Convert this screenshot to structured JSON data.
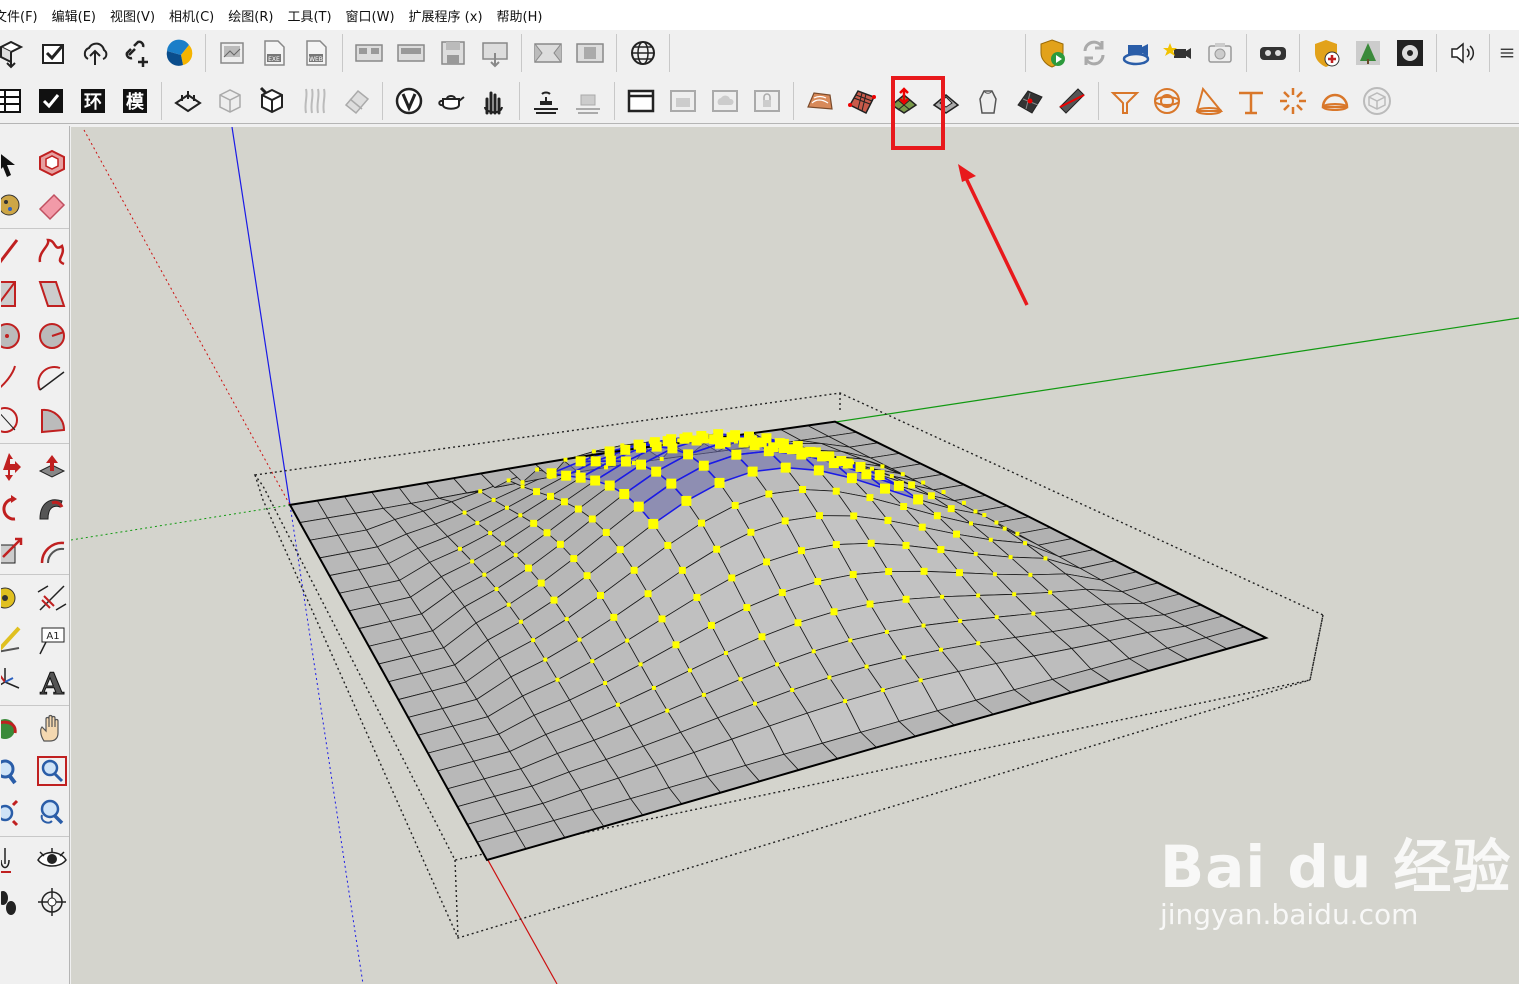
{
  "menu": [
    "文件(F)",
    "编辑(E)",
    "视图(V)",
    "相机(C)",
    "绘图(R)",
    "工具(T)",
    "窗口(W)",
    "扩展程序 (x)",
    "帮助(H)"
  ],
  "toolbar2_text_buttons": [
    "环",
    "模"
  ],
  "left_toolbar_label": "A1",
  "watermark": {
    "brand": "Bai du 经验",
    "url": "jingyan.baidu.com"
  },
  "colors": {
    "highlight": "#e8191c",
    "axis_blue": "#1a1ae6",
    "axis_green": "#119911",
    "axis_red": "#cc1111",
    "vertex": "#ffff00",
    "background": "#d4d4cd"
  },
  "icons": {
    "row1": [
      "components-icon",
      "checklist-icon",
      "cloud-upload-icon",
      "link-add-icon",
      "trimble-logo-icon",
      "export-image-icon",
      "export-exe-icon",
      "export-web-icon",
      "panorama-icon",
      "panorama-2-icon",
      "save-scene-icon",
      "scene-download-icon",
      "layout-icon",
      "layout-2-icon",
      "globe-icon",
      "shield-play-icon",
      "refresh-icon",
      "camera-rotate-icon",
      "camera-star-icon",
      "camera-icon",
      "vr-icon",
      "shield-add-icon",
      "tree-icon",
      "gear-film-icon",
      "speaker-icon",
      "settings-icon"
    ],
    "row2": [
      "grid-icon",
      "checkbox-icon",
      "ring-icon",
      "model-icon",
      "section-icon",
      "box-icon",
      "box-cut-icon",
      "fog-icon",
      "erase-icon",
      "v-logo-icon",
      "teapot-icon",
      "hand-icon",
      "table-icon",
      "table-2-icon",
      "window-icon",
      "window-2-icon",
      "cloud-box-icon",
      "lock-box-icon",
      "terrain-contour-icon",
      "terrain-grid-icon",
      "terrain-stamp-icon",
      "terrain-drape-icon",
      "terrain-smoove-icon",
      "terrain-flip-icon",
      "terrain-add-detail-icon",
      "funnel-icon",
      "disc-icon",
      "cone-icon",
      "pin-icon",
      "sun-icon",
      "dome-icon",
      "box-outline-icon"
    ]
  }
}
